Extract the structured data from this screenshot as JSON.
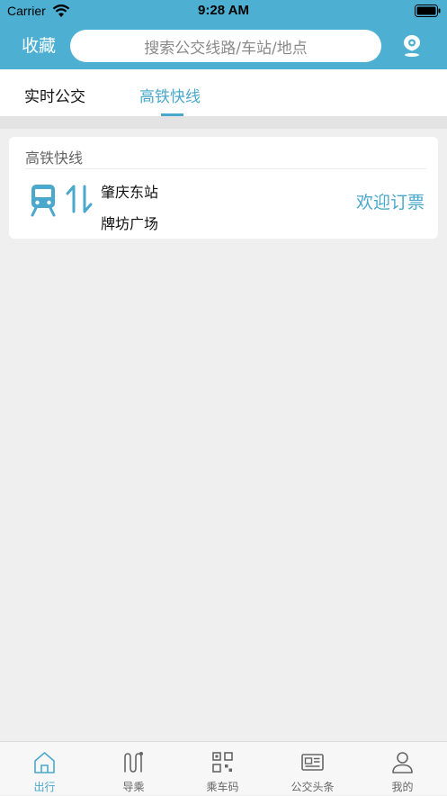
{
  "status_bar": {
    "carrier": "Carrier",
    "time": "9:28 AM"
  },
  "header": {
    "favorites_label": "收藏",
    "search_placeholder": "搜索公交线路/车站/地点",
    "location_icon": "location-pin-icon"
  },
  "tabs": [
    {
      "label": "实时公交",
      "active": false
    },
    {
      "label": "高铁快线",
      "active": true
    }
  ],
  "card": {
    "title": "高铁快线",
    "from_station": "肇庆东站",
    "to_station": "牌坊广场",
    "action_label": "欢迎订票",
    "icons": [
      "train-icon",
      "swap-arrows-icon"
    ]
  },
  "bottom_nav": [
    {
      "label": "出行",
      "icon": "home-icon",
      "active": true
    },
    {
      "label": "导乘",
      "icon": "route-icon",
      "active": false
    },
    {
      "label": "乘车码",
      "icon": "qr-code-icon",
      "active": false
    },
    {
      "label": "公交头条",
      "icon": "newspaper-icon",
      "active": false
    },
    {
      "label": "我的",
      "icon": "user-icon",
      "active": false
    }
  ],
  "colors": {
    "brand": "#4db0d2",
    "accent": "#4aa8cd",
    "background": "#efefef"
  }
}
